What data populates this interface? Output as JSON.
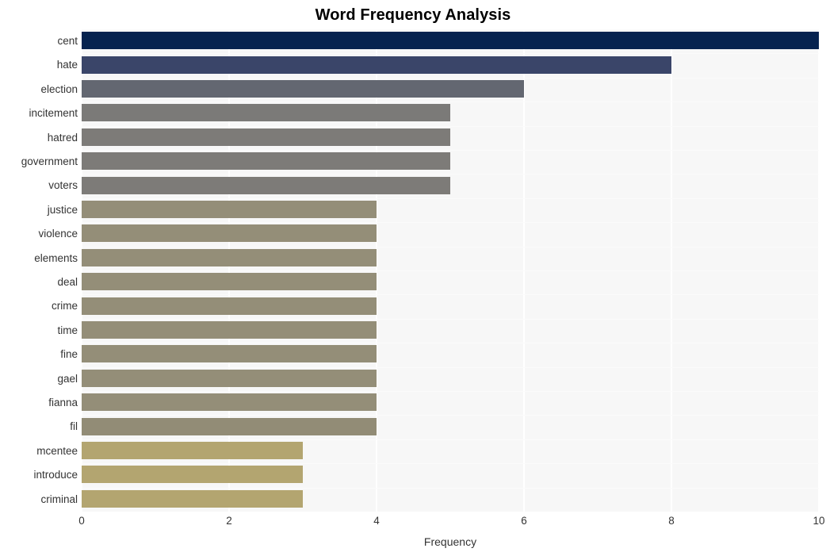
{
  "chart_data": {
    "type": "bar",
    "orientation": "horizontal",
    "title": "Word Frequency Analysis",
    "xlabel": "Frequency",
    "ylabel": "",
    "xlim": [
      0,
      10
    ],
    "xticks": [
      0,
      2,
      4,
      6,
      8,
      10
    ],
    "xticklabels": [
      "0",
      "2",
      "4",
      "6",
      "8",
      "10"
    ],
    "grid": true,
    "legend": null,
    "categories": [
      "cent",
      "hate",
      "election",
      "incitement",
      "hatred",
      "government",
      "voters",
      "justice",
      "violence",
      "elements",
      "deal",
      "crime",
      "time",
      "fine",
      "gael",
      "fianna",
      "fil",
      "mcentee",
      "introduce",
      "criminal"
    ],
    "values": [
      10,
      8,
      6,
      5,
      5,
      5,
      5,
      4,
      4,
      4,
      4,
      4,
      4,
      4,
      4,
      4,
      4,
      3,
      3,
      3
    ],
    "bar_colors": [
      "#06234f",
      "#3a4569",
      "#636771",
      "#7b7a78",
      "#7d7b78",
      "#7d7b78",
      "#7d7b78",
      "#948e78",
      "#948e78",
      "#948e78",
      "#948e78",
      "#948e78",
      "#948e78",
      "#948e78",
      "#948e78",
      "#948e78",
      "#928c76",
      "#b3a570",
      "#b3a570",
      "#b3a570"
    ]
  },
  "style": {
    "figure_background": "#ffffff",
    "plot_background": "#f7f7f7",
    "gridline_color": "#ffffff",
    "tick_label_color": "#333333",
    "title_color": "#000000"
  }
}
